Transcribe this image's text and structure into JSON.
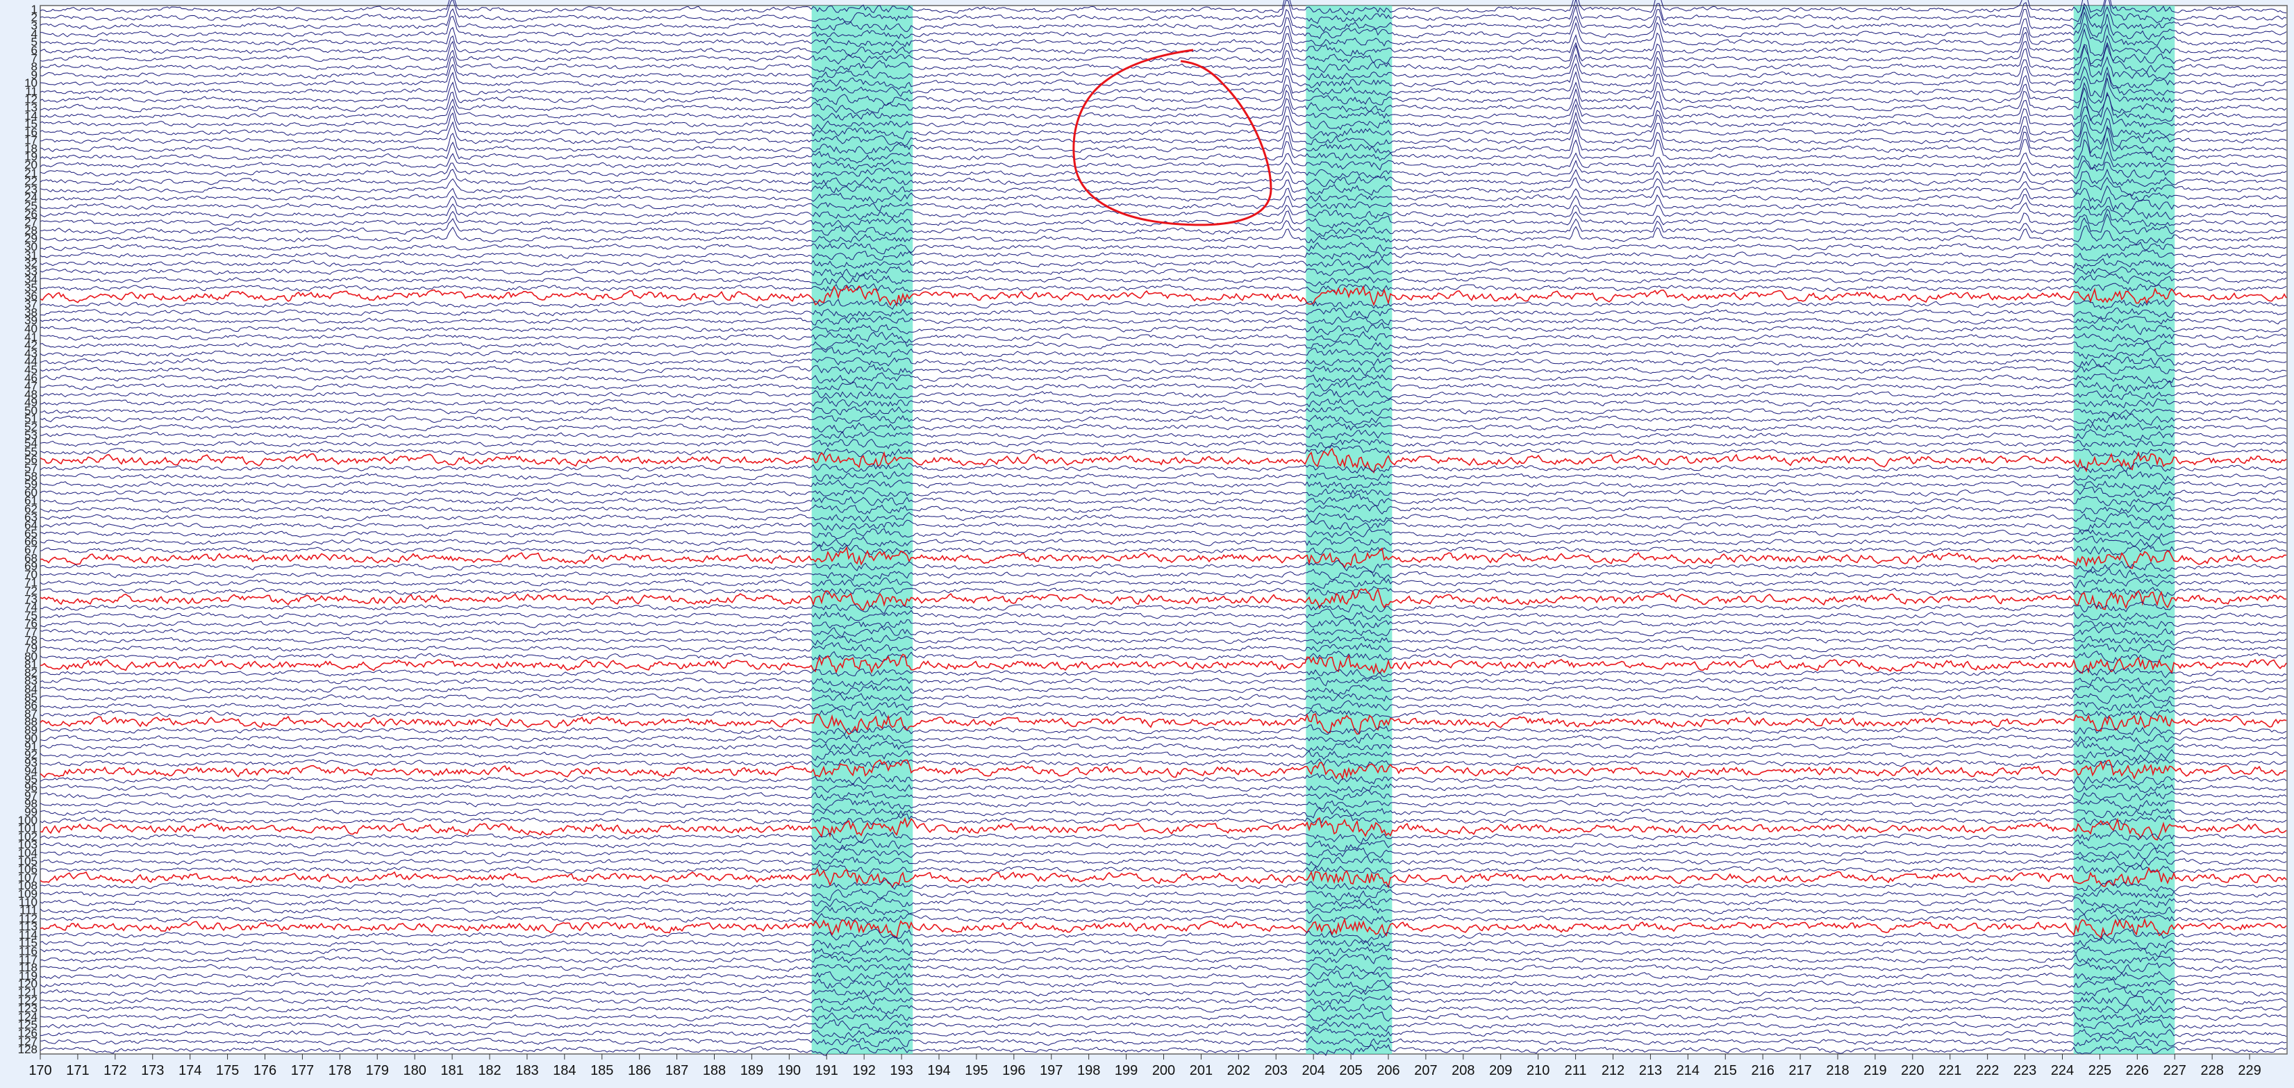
{
  "viewer": {
    "channel_count": 128,
    "channel_labels": [
      "1",
      "2",
      "3",
      "4",
      "5",
      "6",
      "7",
      "8",
      "9",
      "10",
      "11",
      "12",
      "13",
      "14",
      "15",
      "16",
      "17",
      "18",
      "19",
      "20",
      "21",
      "22",
      "23",
      "24",
      "25",
      "26",
      "27",
      "28",
      "29",
      "30",
      "31",
      "32",
      "33",
      "34",
      "35",
      "36",
      "37",
      "38",
      "39",
      "40",
      "41",
      "42",
      "43",
      "44",
      "45",
      "46",
      "47",
      "48",
      "49",
      "50",
      "51",
      "52",
      "53",
      "54",
      "55",
      "56",
      "57",
      "58",
      "59",
      "60",
      "61",
      "62",
      "63",
      "64",
      "65",
      "66",
      "67",
      "68",
      "69",
      "70",
      "71",
      "72",
      "73",
      "74",
      "75",
      "76",
      "77",
      "78",
      "79",
      "80",
      "81",
      "82",
      "83",
      "84",
      "85",
      "86",
      "87",
      "88",
      "89",
      "90",
      "91",
      "92",
      "93",
      "94",
      "95",
      "96",
      "97",
      "98",
      "99",
      "100",
      "101",
      "102",
      "103",
      "104",
      "105",
      "106",
      "107",
      "108",
      "109",
      "110",
      "111",
      "112",
      "113",
      "114",
      "115",
      "116",
      "117",
      "118",
      "119",
      "120",
      "121",
      "122",
      "123",
      "124",
      "125",
      "126",
      "127",
      "128"
    ],
    "time_labels": [
      "170",
      "171",
      "172",
      "173",
      "174",
      "175",
      "176",
      "177",
      "178",
      "179",
      "180",
      "181",
      "182",
      "183",
      "184",
      "185",
      "186",
      "187",
      "188",
      "189",
      "190",
      "191",
      "192",
      "193",
      "194",
      "195",
      "196",
      "197",
      "198",
      "199",
      "200",
      "201",
      "202",
      "203",
      "204",
      "205",
      "206",
      "207",
      "208",
      "209",
      "210",
      "211",
      "212",
      "213",
      "214",
      "215",
      "216",
      "217",
      "218",
      "219",
      "220",
      "221",
      "222",
      "223",
      "224",
      "225",
      "226",
      "227",
      "228",
      "229"
    ],
    "time_range": [
      170,
      230
    ],
    "highlighted_segments": [
      [
        190.6,
        193.3
      ],
      [
        203.8,
        206.1
      ],
      [
        224.3,
        227.0
      ]
    ],
    "bad_channels": [
      36,
      56,
      68,
      73,
      81,
      88,
      94,
      101,
      107,
      113
    ],
    "colors": {
      "background": "#ffffff",
      "trace": "#1a1a7a",
      "bad_trace": "#e8141a",
      "highlight": "#66e6cc",
      "annotation": "#e8141a",
      "page_bg": "#e8f0fb"
    }
  }
}
